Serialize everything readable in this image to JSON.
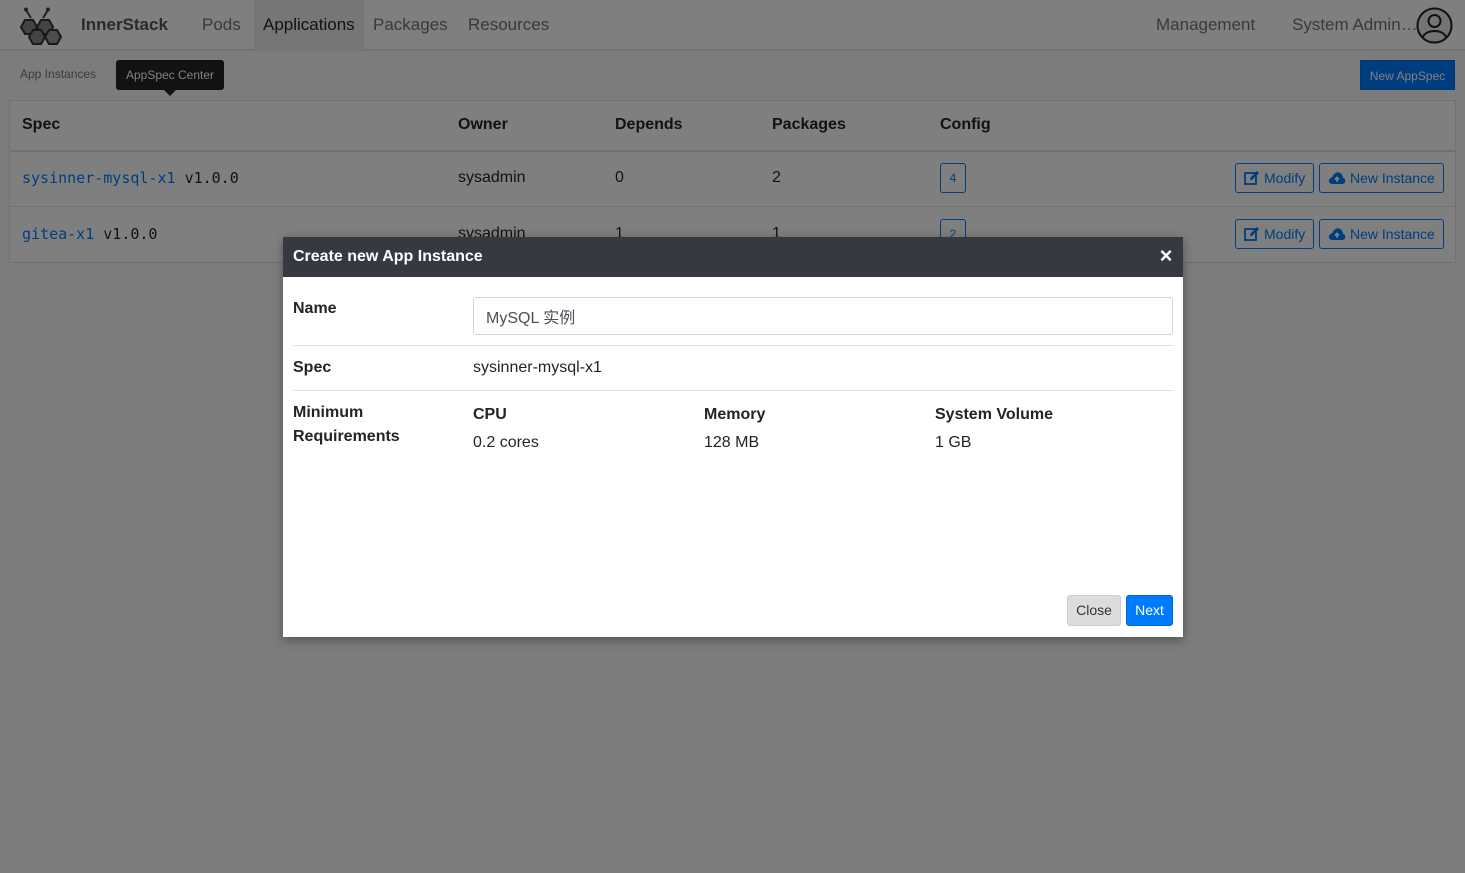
{
  "navbar": {
    "brand": "InnerStack",
    "items": [
      {
        "label": "Pods"
      },
      {
        "label": "Applications"
      },
      {
        "label": "Packages"
      },
      {
        "label": "Resources"
      }
    ],
    "management_label": "Management",
    "user_label": "System Admin…"
  },
  "subnav": {
    "app_instances_label": "App Instances",
    "tooltip_label": "AppSpec Center",
    "new_appspec_label": "New AppSpec"
  },
  "table": {
    "headers": {
      "spec": "Spec",
      "owner": "Owner",
      "depends": "Depends",
      "packages": "Packages",
      "config": "Config"
    },
    "rows": [
      {
        "spec_name": "sysinner-mysql-x1",
        "version": "v1.0.0",
        "owner": "sysadmin",
        "depends": "0",
        "packages": "2",
        "config": "4",
        "modify_label": "Modify",
        "new_instance_label": "New Instance"
      },
      {
        "spec_name": "gitea-x1",
        "version": "v1.0.0",
        "owner": "sysadmin",
        "depends": "1",
        "packages": "1",
        "config": "2",
        "modify_label": "Modify",
        "new_instance_label": "New Instance"
      }
    ]
  },
  "modal": {
    "title": "Create new App Instance",
    "close_glyph": "×",
    "name_label": "Name",
    "name_value": "MySQL 实例",
    "spec_label": "Spec",
    "spec_value": "sysinner-mysql-x1",
    "requirements_label_line1": "Minimum",
    "requirements_label_line2": "Requirements",
    "cpu_label": "CPU",
    "cpu_value": "0.2 cores",
    "memory_label": "Memory",
    "memory_value": "128 MB",
    "volume_label": "System Volume",
    "volume_value": "1 GB",
    "close_button_label": "Close",
    "next_button_label": "Next"
  },
  "colors": {
    "primary": "#007bff",
    "header_dark": "#343a40",
    "backdrop": "rgba(0,0,0,0.5)"
  }
}
